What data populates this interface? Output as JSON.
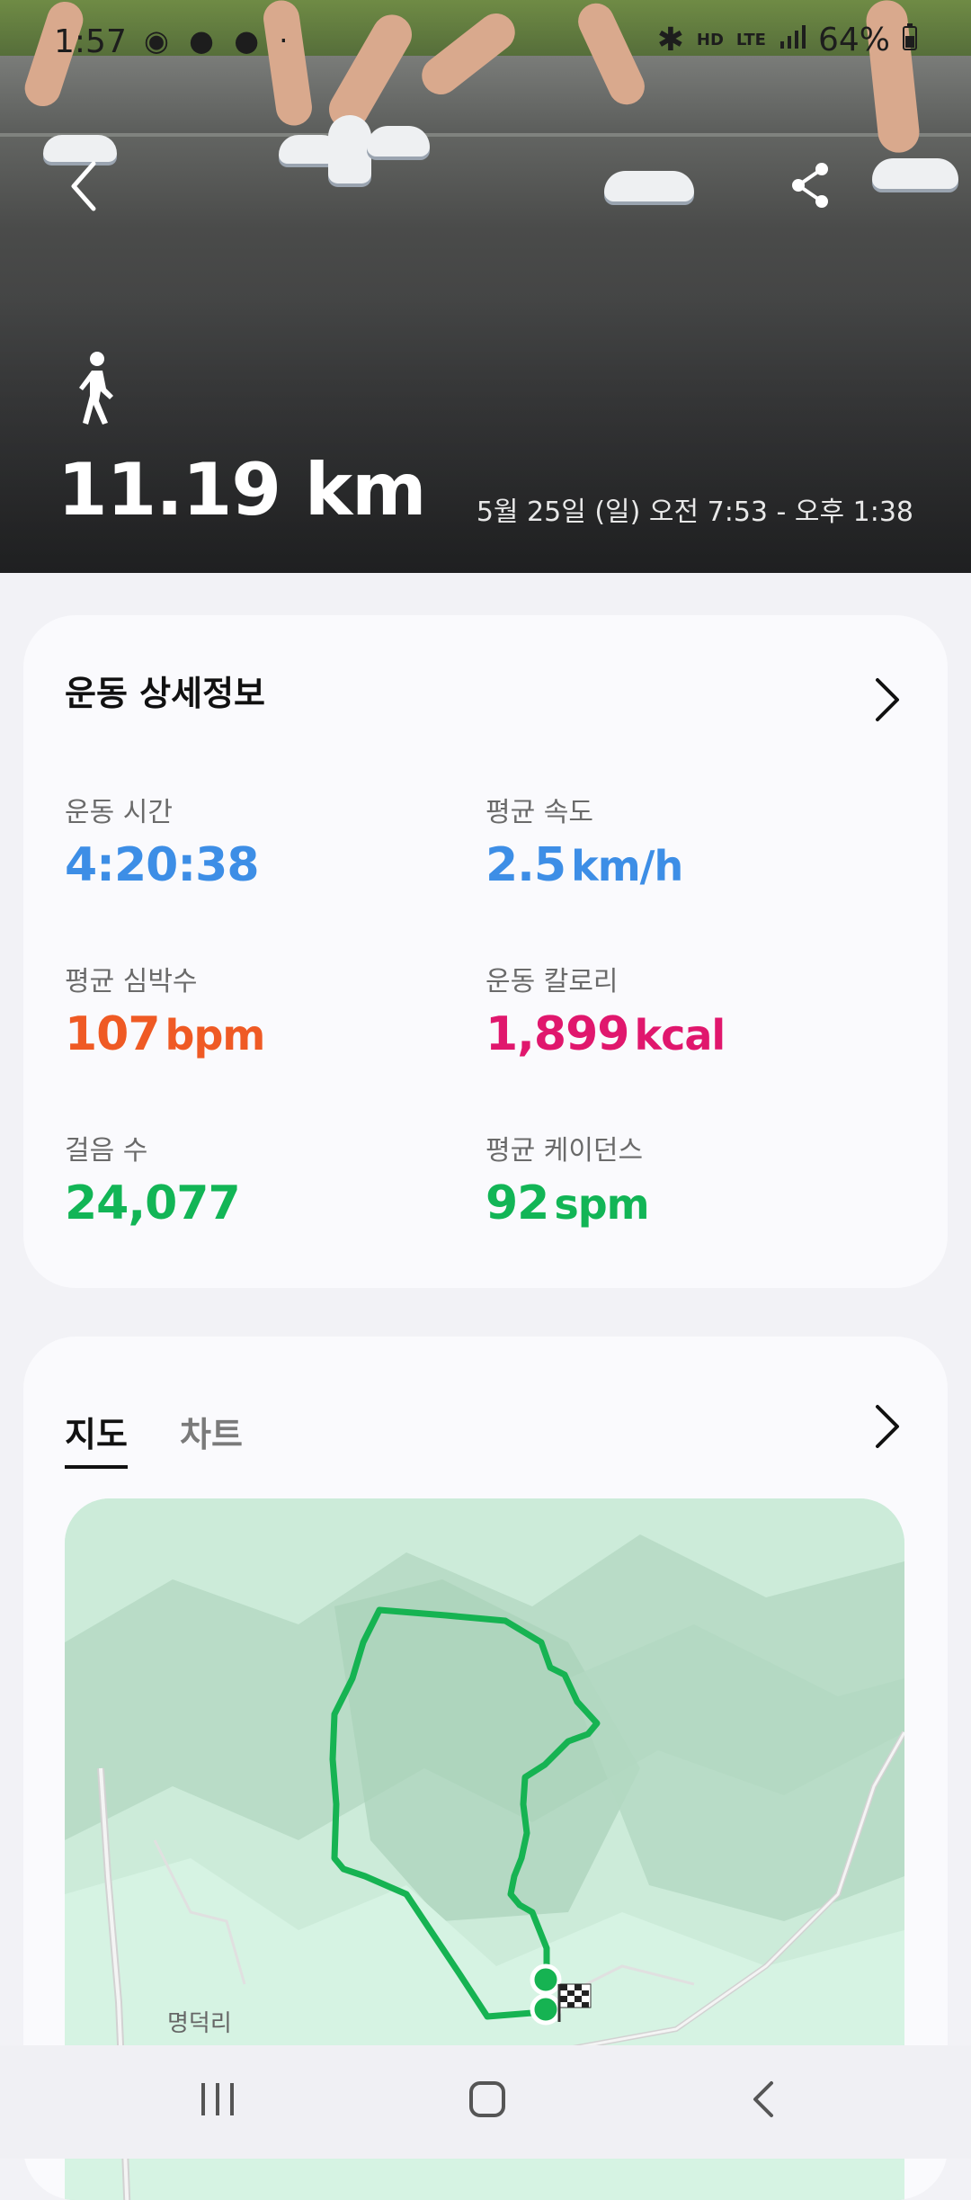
{
  "status_bar": {
    "time": "1:57",
    "notif_icons": "◉ ● ● ·",
    "hd": "HD",
    "lte": "LTE",
    "battery": "64%"
  },
  "header": {
    "distance": "11.19 km",
    "datetime": "5월 25일 (일) 오전 7:53 - 오후 1:38"
  },
  "details": {
    "title": "운동 상세정보",
    "metrics": [
      {
        "label": "운동 시간",
        "value": "4:20:38",
        "unit": "",
        "color": "#3d8ee6"
      },
      {
        "label": "평균 속도",
        "value": "2.5",
        "unit": "km/h",
        "color": "#3d8ee6"
      },
      {
        "label": "평균 심박수",
        "value": "107",
        "unit": "bpm",
        "color": "#ef5a24"
      },
      {
        "label": "운동 칼로리",
        "value": "1,899",
        "unit": "kcal",
        "color": "#e0176d"
      },
      {
        "label": "걸음 수",
        "value": "24,077",
        "unit": "",
        "color": "#12b556"
      },
      {
        "label": "평균 케이던스",
        "value": "92",
        "unit": "spm",
        "color": "#12b556"
      }
    ]
  },
  "map_card": {
    "tabs": [
      {
        "label": "지도",
        "active": true
      },
      {
        "label": "차트",
        "active": false
      }
    ],
    "place_label": "명덕리",
    "route_color": "#16b352"
  },
  "icons": {
    "back": "chevron-left-icon",
    "share": "share-icon",
    "activity": "walking-icon",
    "detail_arrow": "chevron-right-icon",
    "finish": "checkered-flag-icon"
  }
}
